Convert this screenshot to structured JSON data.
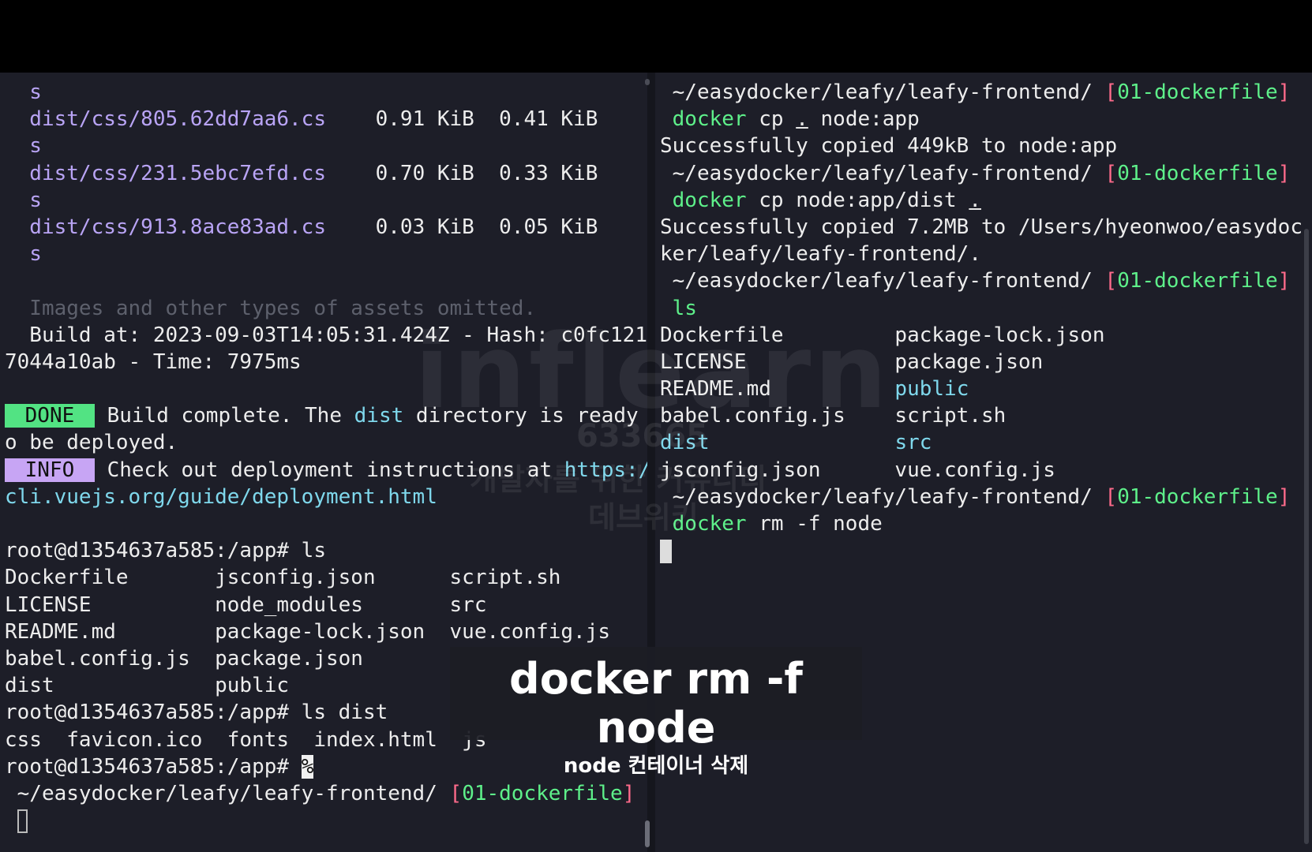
{
  "left_terminal": {
    "lines": [
      [
        {
          "t": "  s",
          "c": "c-purple"
        }
      ],
      [
        {
          "t": "  dist/css/805.62dd7aa6.cs",
          "c": "c-purple"
        },
        {
          "t": "    0.91 KiB  0.41 KiB",
          "c": "c-white"
        }
      ],
      [
        {
          "t": "  s",
          "c": "c-purple"
        }
      ],
      [
        {
          "t": "  dist/css/231.5ebc7efd.cs",
          "c": "c-purple"
        },
        {
          "t": "    0.70 KiB  0.33 KiB",
          "c": "c-white"
        }
      ],
      [
        {
          "t": "  s",
          "c": "c-purple"
        }
      ],
      [
        {
          "t": "  dist/css/913.8ace83ad.cs",
          "c": "c-purple"
        },
        {
          "t": "    0.03 KiB  0.05 KiB",
          "c": "c-white"
        }
      ],
      [
        {
          "t": "  s",
          "c": "c-purple"
        }
      ],
      [],
      [
        {
          "t": "  Images and other types of assets omitted.",
          "c": "c-gray"
        }
      ],
      [
        {
          "t": "  Build at: 2023-09-03T14:05:31.424Z - Hash: c0fc121",
          "c": "c-white"
        }
      ],
      [
        {
          "t": "7044a10ab - Time: 7975ms",
          "c": "c-white"
        }
      ],
      [],
      [
        {
          "t": " DONE ",
          "c": "badge-done"
        },
        {
          "t": " Build complete. The ",
          "c": "c-white"
        },
        {
          "t": "dist",
          "c": "c-cyan"
        },
        {
          "t": " directory is ready t",
          "c": "c-white"
        }
      ],
      [
        {
          "t": "o be deployed.",
          "c": "c-white"
        }
      ],
      [
        {
          "t": " INFO ",
          "c": "badge-info"
        },
        {
          "t": " Check out deployment instructions at ",
          "c": "c-white"
        },
        {
          "t": "https://",
          "c": "c-cyan"
        }
      ],
      [
        {
          "t": "cli.vuejs.org/guide/deployment.html",
          "c": "c-cyan"
        }
      ],
      [],
      [
        {
          "t": "root@d1354637a585:/app# ls",
          "c": "c-white"
        }
      ],
      [
        {
          "t": "Dockerfile       jsconfig.json      script.sh",
          "c": "c-white"
        }
      ],
      [
        {
          "t": "LICENSE          node_modules       src",
          "c": "c-white"
        }
      ],
      [
        {
          "t": "README.md        package-lock.json  vue.config.js",
          "c": "c-white"
        }
      ],
      [
        {
          "t": "babel.config.js  package.json",
          "c": "c-white"
        }
      ],
      [
        {
          "t": "dist             public",
          "c": "c-white"
        }
      ],
      [
        {
          "t": "root@d1354637a585:/app# ls dist",
          "c": "c-white"
        }
      ],
      [
        {
          "t": "css  favicon.ico  fonts  index.html  js",
          "c": "c-white"
        }
      ],
      [
        {
          "t": "root@d1354637a585:/app# ",
          "c": "c-white"
        },
        {
          "t": "%",
          "c": "cursor-inv"
        }
      ],
      [
        {
          "t": "",
          "c": "apple"
        },
        {
          "t": " ~/easydocker/leafy/leafy-frontend/ ",
          "c": "c-white"
        },
        {
          "t": "[",
          "c": "c-pink"
        },
        {
          "t": "01-dockerfile",
          "c": "c-green"
        },
        {
          "t": "]",
          "c": "c-pink"
        }
      ],
      [
        {
          "t": " ",
          "c": "c-white"
        },
        {
          "t": "",
          "c": "cursor-hollow"
        }
      ]
    ]
  },
  "right_terminal": {
    "lines": [
      [
        {
          "t": "",
          "c": "apple"
        },
        {
          "t": " ~/easydocker/leafy/leafy-frontend/ ",
          "c": "c-white"
        },
        {
          "t": "[",
          "c": "c-pink"
        },
        {
          "t": "01-dockerfile",
          "c": "c-green"
        },
        {
          "t": "]",
          "c": "c-pink"
        }
      ],
      [
        {
          "t": " docker",
          "c": "c-green"
        },
        {
          "t": " cp ",
          "c": "c-white"
        },
        {
          "t": ".",
          "c": "underline"
        },
        {
          "t": " node:app",
          "c": "c-white"
        }
      ],
      [
        {
          "t": "Successfully copied 449kB to node:app",
          "c": "c-white"
        }
      ],
      [
        {
          "t": "",
          "c": "apple"
        },
        {
          "t": " ~/easydocker/leafy/leafy-frontend/ ",
          "c": "c-white"
        },
        {
          "t": "[",
          "c": "c-pink"
        },
        {
          "t": "01-dockerfile",
          "c": "c-green"
        },
        {
          "t": "]",
          "c": "c-pink"
        }
      ],
      [
        {
          "t": " docker",
          "c": "c-green"
        },
        {
          "t": " cp node:app/dist ",
          "c": "c-white"
        },
        {
          "t": ".",
          "c": "underline"
        }
      ],
      [
        {
          "t": "Successfully copied 7.2MB to /Users/hyeonwoo/easydoc",
          "c": "c-white"
        }
      ],
      [
        {
          "t": "ker/leafy/leafy-frontend/.",
          "c": "c-white"
        }
      ],
      [
        {
          "t": "",
          "c": "apple"
        },
        {
          "t": " ~/easydocker/leafy/leafy-frontend/ ",
          "c": "c-white"
        },
        {
          "t": "[",
          "c": "c-pink"
        },
        {
          "t": "01-dockerfile",
          "c": "c-green"
        },
        {
          "t": "]",
          "c": "c-pink"
        }
      ],
      [
        {
          "t": " ls",
          "c": "c-green"
        }
      ],
      [
        {
          "t": "Dockerfile         package-lock.json",
          "c": "c-white"
        }
      ],
      [
        {
          "t": "LICENSE            package.json",
          "c": "c-white"
        }
      ],
      [
        {
          "t": "README.md          ",
          "c": "c-white"
        },
        {
          "t": "public",
          "c": "c-cyan"
        }
      ],
      [
        {
          "t": "babel.config.js    script.sh",
          "c": "c-white"
        }
      ],
      [
        {
          "t": "dist",
          "c": "c-cyan"
        },
        {
          "t": "               ",
          "c": "c-white"
        },
        {
          "t": "src",
          "c": "c-cyan"
        }
      ],
      [
        {
          "t": "jsconfig.json      vue.config.js",
          "c": "c-white"
        }
      ],
      [
        {
          "t": "",
          "c": "apple"
        },
        {
          "t": " ~/easydocker/leafy/leafy-frontend/ ",
          "c": "c-white"
        },
        {
          "t": "[",
          "c": "c-pink"
        },
        {
          "t": "01-dockerfile",
          "c": "c-green"
        },
        {
          "t": "]",
          "c": "c-pink"
        }
      ],
      [
        {
          "t": " docker",
          "c": "c-green"
        },
        {
          "t": " rm -f node",
          "c": "c-white"
        }
      ],
      [
        {
          "t": "",
          "c": "cursor-block"
        }
      ]
    ]
  },
  "watermark": {
    "logo": "inflearn",
    "number": "633665",
    "line1": "개발자를 위한 커뮤니티",
    "line2": "데브위키"
  },
  "caption": {
    "main": "docker rm -f node",
    "sub": "node 컨테이너 삭제"
  }
}
